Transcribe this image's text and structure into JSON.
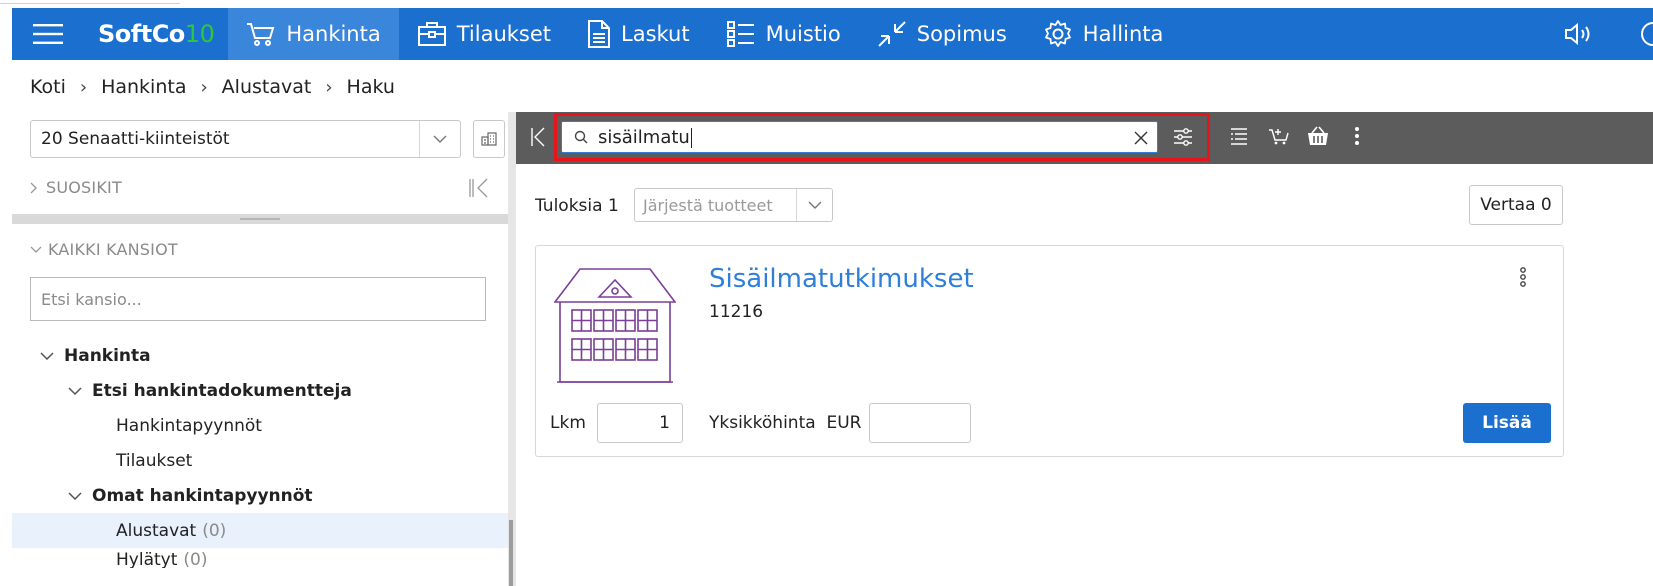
{
  "nav": {
    "brand_main": "SoftCo",
    "brand_version": "10",
    "items": [
      {
        "label": "Hankinta",
        "icon": "cart-icon",
        "active": true
      },
      {
        "label": "Tilaukset",
        "icon": "briefcase-icon"
      },
      {
        "label": "Laskut",
        "icon": "document-icon"
      },
      {
        "label": "Muistio",
        "icon": "list-icon"
      },
      {
        "label": "Sopimus",
        "icon": "arrows-in-icon"
      },
      {
        "label": "Hallinta",
        "icon": "gear-icon"
      }
    ],
    "colors": {
      "bar": "#1b6fce",
      "active": "#3a86db",
      "brand_version": "#2ec63f"
    }
  },
  "breadcrumb": [
    "Koti",
    "Hankinta",
    "Alustavat",
    "Haku"
  ],
  "left": {
    "organization": "20 Senaatti-kiinteistöt",
    "favorites_label": "SUOSIKIT",
    "all_folders_label": "KAIKKI KANSIOT",
    "folder_search_placeholder": "Etsi kansio...",
    "tree": [
      {
        "label": "Hankinta",
        "level": 0,
        "expanded": true
      },
      {
        "label": "Etsi hankintadokumentteja",
        "level": 1,
        "expanded": true
      },
      {
        "label": "Hankintapyynnöt",
        "level": 2
      },
      {
        "label": "Tilaukset",
        "level": 2
      },
      {
        "label": "Omat hankintapyynnöt",
        "level": 1,
        "expanded": true
      },
      {
        "label": "Alustavat",
        "level": 2,
        "count": "(0)",
        "selected": true
      },
      {
        "label": "Hylätyt",
        "level": 2,
        "count": "(0)"
      }
    ]
  },
  "search": {
    "value": "sisäilmatu",
    "highlight_color": "#e8141c"
  },
  "results": {
    "count_label": "Tuloksia 1",
    "sort_placeholder": "Järjestä tuotteet",
    "compare_label": "Vertaa 0"
  },
  "product": {
    "title": "Sisäilmatutkimukset",
    "code": "11216",
    "image_icon": "building-icon",
    "qty_label": "Lkm",
    "qty_value": "1",
    "price_label": "Yksikköhinta",
    "currency": "EUR",
    "price_value": "",
    "add_label": "Lisää"
  }
}
